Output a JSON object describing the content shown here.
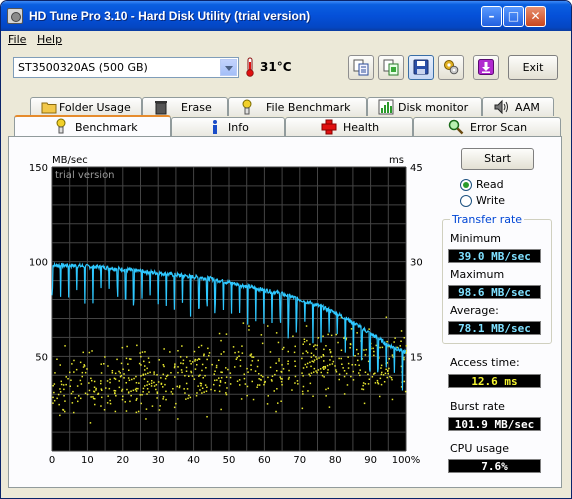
{
  "window": {
    "title": "HD Tune Pro 3.10 - Hard Disk Utility (trial version)"
  },
  "menu": {
    "file_label": "File",
    "help_label": "Help"
  },
  "toolbar": {
    "drive": "ST3500320AS (500 GB)",
    "temperature": "31°C",
    "exit_label": "Exit",
    "buttons": [
      "copy-text-icon",
      "copy-image-icon",
      "save-icon",
      "options-icon",
      "download-icon"
    ]
  },
  "tabs": {
    "row1": [
      "Folder Usage",
      "Erase",
      "File Benchmark",
      "Disk monitor",
      "AAM"
    ],
    "row2": [
      "Benchmark",
      "Info",
      "Health",
      "Error Scan"
    ],
    "selected": "Benchmark"
  },
  "benchmark": {
    "start_label": "Start",
    "read_label": "Read",
    "write_label": "Write",
    "mode": "Read",
    "transfer_rate_title": "Transfer rate",
    "minimum_label": "Minimum",
    "minimum_value": "39.0 MB/sec",
    "maximum_label": "Maximum",
    "maximum_value": "98.6 MB/sec",
    "average_label": "Average:",
    "average_value": "78.1 MB/sec",
    "access_time_label": "Access time:",
    "access_time_value": "12.6 ms",
    "burst_rate_label": "Burst rate",
    "burst_rate_value": "101.9 MB/sec",
    "cpu_usage_label": "CPU usage",
    "cpu_usage_value": "7.6%"
  },
  "chart_data": {
    "type": "line",
    "watermark": "trial version",
    "left_unit": "MB/sec",
    "right_unit": "ms",
    "ylim_left": [
      0,
      150
    ],
    "ylim_right": [
      0,
      45
    ],
    "xlim": [
      0,
      100
    ],
    "left_ticks": [
      150,
      100,
      50
    ],
    "right_ticks": [
      45,
      30,
      15
    ],
    "x_ticks": [
      "0",
      "10",
      "20",
      "30",
      "40",
      "50",
      "60",
      "70",
      "80",
      "90",
      "100%"
    ],
    "grid": true,
    "series": [
      {
        "kind": "transfer-rate",
        "color": "#2ec8ff",
        "x": [
          0,
          5,
          10,
          15,
          20,
          25,
          30,
          35,
          40,
          45,
          50,
          55,
          60,
          65,
          70,
          75,
          80,
          85,
          90,
          95,
          100
        ],
        "y": [
          98,
          98,
          97.5,
          97,
          96,
          95,
          94,
          93,
          92,
          91,
          89,
          87,
          85,
          83,
          80,
          77,
          73,
          68,
          62,
          56,
          52
        ]
      },
      {
        "kind": "access-time",
        "color": "#e8e830",
        "x": [
          0,
          10,
          20,
          30,
          40,
          50,
          60,
          70,
          80,
          90,
          100
        ],
        "y_ms": [
          10,
          10.5,
          11,
          11.5,
          12,
          12.5,
          13,
          13.5,
          14.5,
          14,
          13
        ]
      }
    ]
  },
  "colors": {
    "titlebar": "#0550d8",
    "chart_background": "#000000",
    "transfer_line": "#2ec8ff",
    "access_points": "#e8e830",
    "group_title": "#0046d5",
    "selected_tab_accent": "#e68b2c"
  }
}
